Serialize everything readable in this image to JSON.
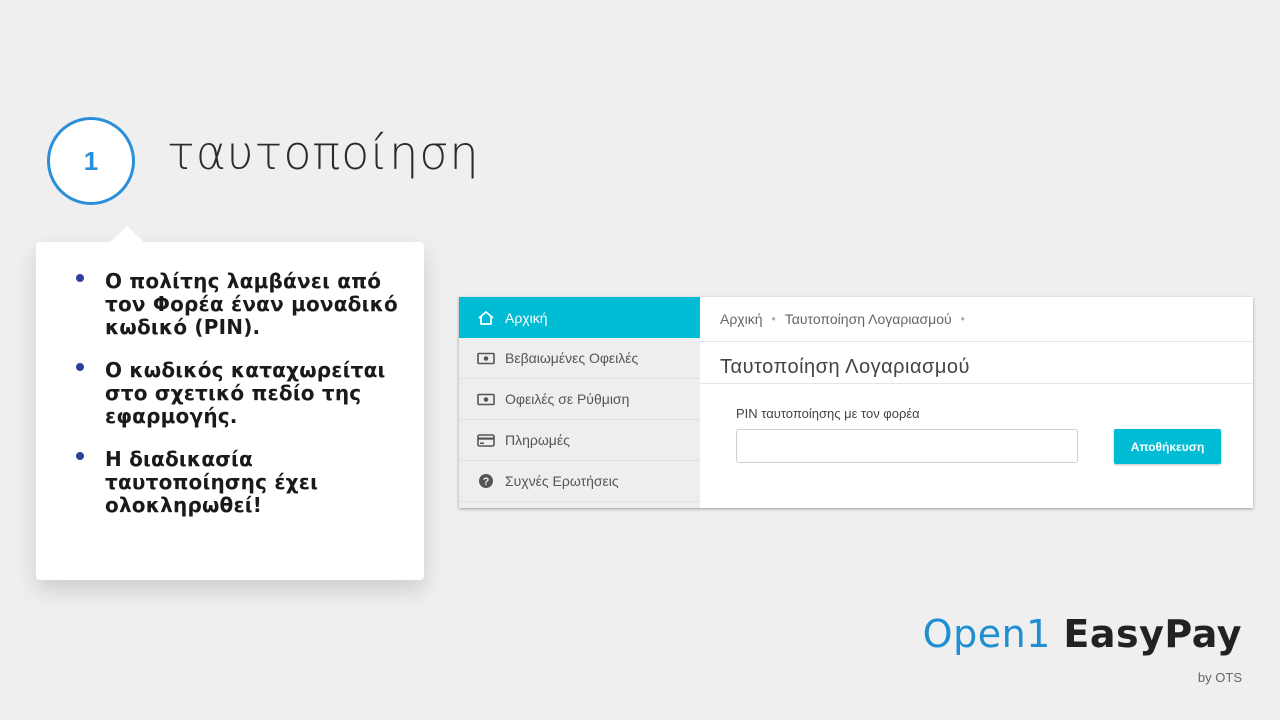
{
  "slide": {
    "step_number": "1",
    "title": "ταυτοποίηση"
  },
  "callout": {
    "bullets": [
      "Ο πολίτης λαμβάνει από τον Φορέα έναν μοναδικό κωδικό (PIN).",
      "Ο κωδικός καταχωρείται στο σχετικό πεδίο της εφαρμογής.",
      "Η διαδικασία ταυτοποίησης έχει ολοκληρωθεί!"
    ]
  },
  "app": {
    "sidebar": {
      "items": [
        {
          "label": "Αρχική",
          "icon": "home-icon",
          "active": true
        },
        {
          "label": "Βεβαιωμένες Οφειλές",
          "icon": "money-icon",
          "active": false
        },
        {
          "label": "Οφειλές σε Ρύθμιση",
          "icon": "money-icon",
          "active": false
        },
        {
          "label": "Πληρωμές",
          "icon": "credit-card-icon",
          "active": false
        },
        {
          "label": "Συχνές Ερωτήσεις",
          "icon": "help-icon",
          "active": false
        }
      ]
    },
    "breadcrumb": {
      "items": [
        "Αρχική",
        "Ταυτοποίηση Λογαριασμού"
      ]
    },
    "page_heading": "Ταυτοποίηση Λογαριασμού",
    "form": {
      "pin_label": "PIN ταυτοποίησης με τον φορέα",
      "pin_value": "",
      "save_label": "Αποθήκευση"
    },
    "colors": {
      "accent": "#00bcd4"
    }
  },
  "brand": {
    "part1": "Open1",
    "part2": "EasyPay",
    "sub": "by OTS"
  },
  "colors": {
    "step_circle": "#2a8fd8",
    "bullet": "#2f3f9e",
    "brand_blue": "#1e8fd2",
    "background": "#efefef"
  }
}
